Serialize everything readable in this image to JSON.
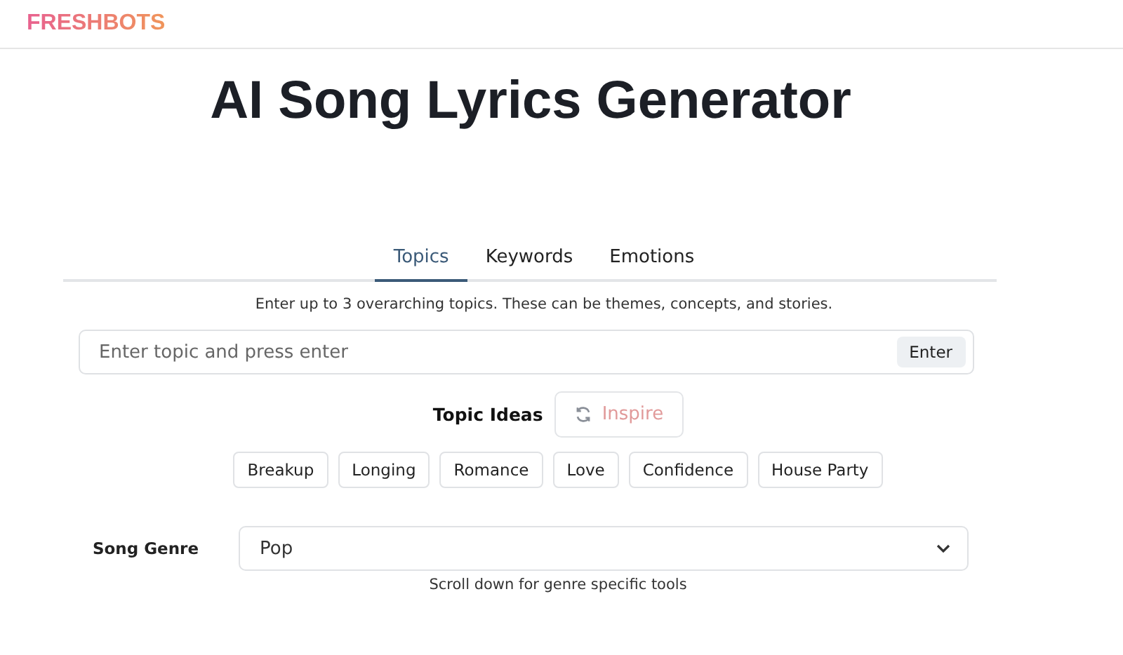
{
  "logo": "FRESHBOTS",
  "title": "AI Song Lyrics Generator",
  "tabs": [
    {
      "label": "Topics",
      "selected": true
    },
    {
      "label": "Keywords",
      "selected": false
    },
    {
      "label": "Emotions",
      "selected": false
    }
  ],
  "hint": "Enter up to 3 overarching topics. These can be themes, concepts, and stories.",
  "topic_field": {
    "placeholder": "Enter topic and press enter",
    "button": "Enter"
  },
  "topic_ideas": {
    "label": "Topic Ideas",
    "button": "Inspire"
  },
  "chips": [
    "Breakup",
    "Longing",
    "Romance",
    "Love",
    "Confidence",
    "House Party"
  ],
  "genre": {
    "label": "Song Genre",
    "value": "Pop",
    "note": "Scroll down for genre specific tools"
  }
}
